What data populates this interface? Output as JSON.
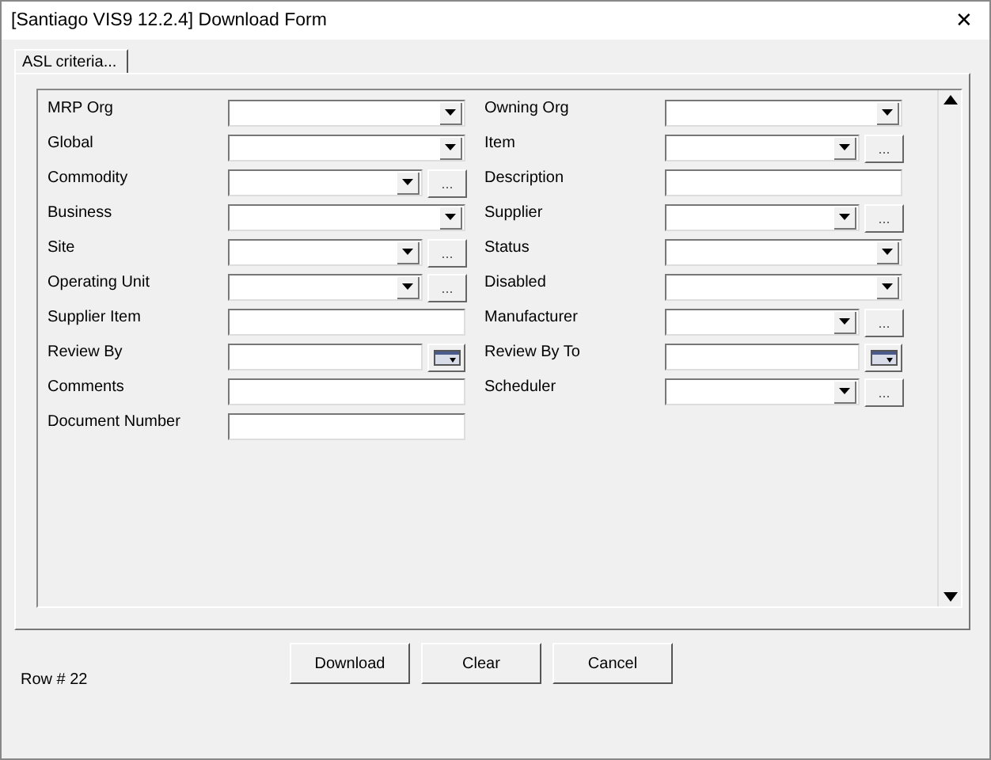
{
  "window": {
    "title": "[Santiago VIS9 12.2.4] Download Form",
    "close": "✕"
  },
  "tabs": [
    {
      "label": "ASL criteria...",
      "selected": true
    }
  ],
  "left_fields": [
    {
      "label": "MRP Org",
      "kind": "combo"
    },
    {
      "label": "Global",
      "kind": "combo"
    },
    {
      "label": "Commodity",
      "kind": "lookup",
      "button": "..."
    },
    {
      "label": "Business",
      "kind": "combo"
    },
    {
      "label": "Site",
      "kind": "lookup",
      "button": "..."
    },
    {
      "label": "Operating Unit",
      "kind": "lookup",
      "button": "..."
    },
    {
      "label": "Supplier Item",
      "kind": "text"
    },
    {
      "label": "Review By",
      "kind": "date"
    },
    {
      "label": "Comments",
      "kind": "text"
    },
    {
      "label": "Document Number",
      "kind": "text"
    }
  ],
  "right_fields": [
    {
      "label": "Owning Org",
      "kind": "combo"
    },
    {
      "label": "Item",
      "kind": "lookup",
      "button": "..."
    },
    {
      "label": "Description",
      "kind": "text"
    },
    {
      "label": "Supplier",
      "kind": "lookup",
      "button": "..."
    },
    {
      "label": "Status",
      "kind": "combo"
    },
    {
      "label": "Disabled",
      "kind": "combo"
    },
    {
      "label": "Manufacturer",
      "kind": "lookup",
      "button": "..."
    },
    {
      "label": "Review By To",
      "kind": "date"
    },
    {
      "label": "Scheduler",
      "kind": "lookup",
      "button": "..."
    }
  ],
  "status": "Row # 22",
  "buttons": [
    "Download",
    "Clear",
    "Cancel"
  ]
}
